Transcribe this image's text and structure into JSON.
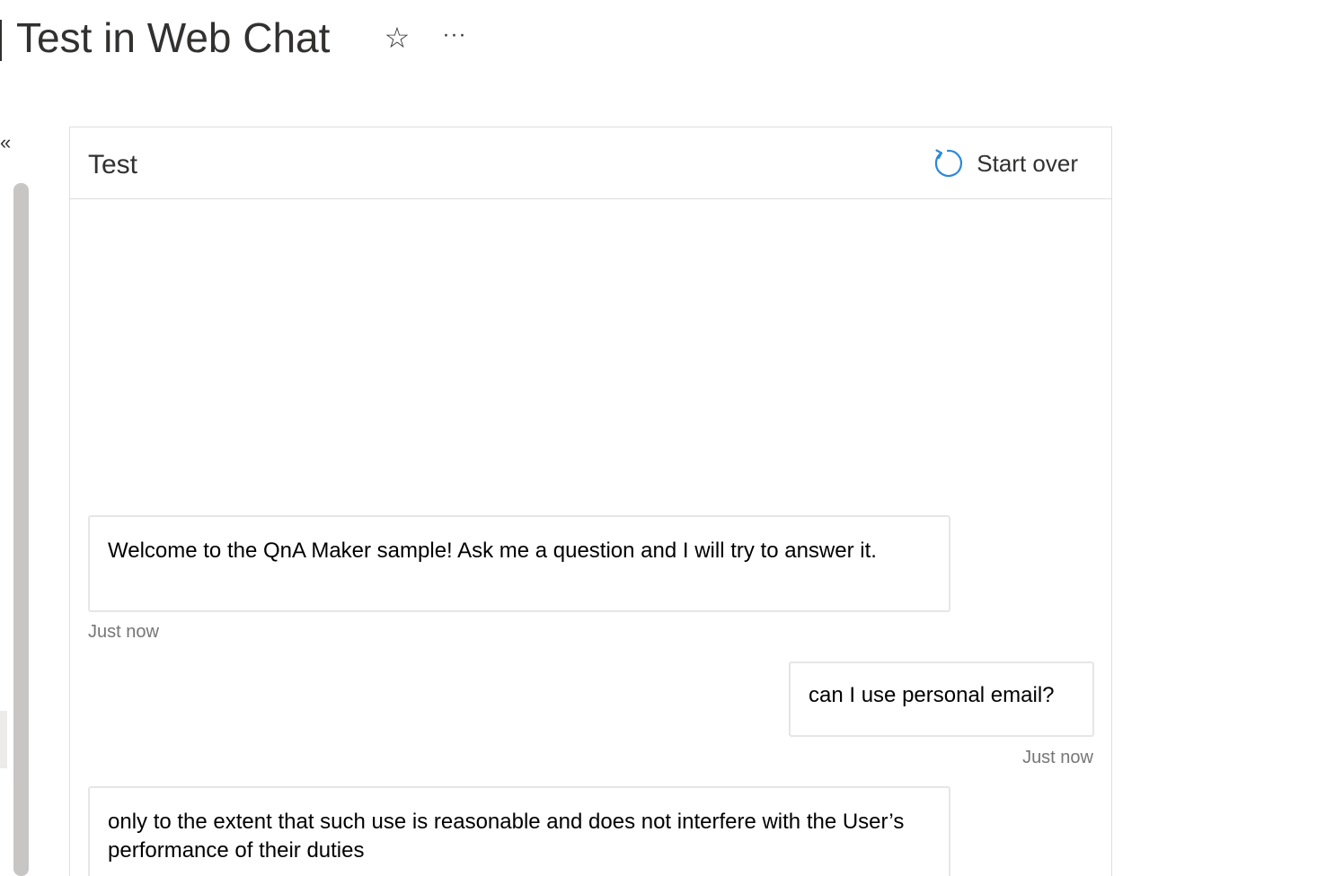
{
  "header": {
    "title": "Test in Web Chat",
    "favorite_icon": "☆",
    "more_icon": "···"
  },
  "sidebar": {
    "collapse_icon": "«"
  },
  "chat": {
    "title": "Test",
    "start_over_label": "Start over",
    "accent_color": "#2b88d8",
    "messages": [
      {
        "role": "bot",
        "text": "Welcome to the QnA Maker sample! Ask me a question and I will try to answer it.",
        "timestamp": "Just now"
      },
      {
        "role": "user",
        "text": "can I use personal email?",
        "timestamp": "Just now"
      },
      {
        "role": "bot",
        "text": "only to the extent that such use is reasonable and does not interfere with the User’s performance of their duties"
      }
    ]
  }
}
